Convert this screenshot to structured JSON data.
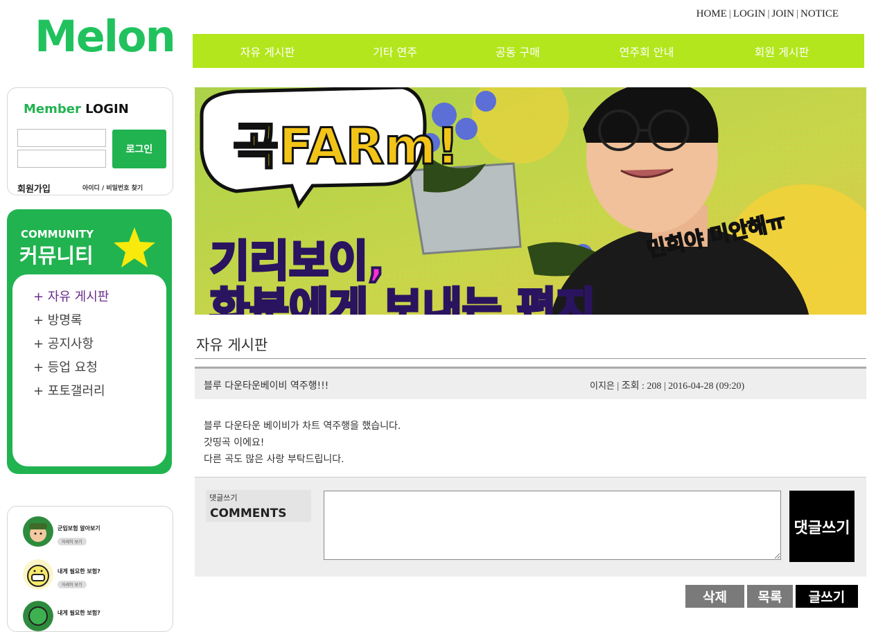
{
  "logo": {
    "text": "Melon",
    "color": "#21c25e"
  },
  "top_links": [
    "HOME",
    "LOGIN",
    "JOIN",
    "NOTICE"
  ],
  "nav": [
    "자유 게시판",
    "기타 연주",
    "공동 구매",
    "연주회 안내",
    "회원 게시판"
  ],
  "login": {
    "title_green": "Member",
    "title_black": "LOGIN",
    "button": "로그인",
    "join": "회원가입",
    "find": "아이디 / 비밀번호 찾기"
  },
  "community": {
    "title_en": "COMMUNITY",
    "title_ko": "커뮤니티",
    "items": [
      "+ 자유 게시판",
      "+ 방명록",
      "+ 공지사항",
      "+ 등업 요청",
      "+ 포토갤러리"
    ]
  },
  "side_banners": [
    {
      "title": "군입보험 알아보기",
      "pill": "자세히 보기"
    },
    {
      "title": "내게 필요한 보험?",
      "pill": "자세히 보기"
    },
    {
      "title": "내게 필요한 보험?"
    }
  ],
  "hero": {
    "bubble_text": "곡FARm!",
    "caption_line1": "기리보이,",
    "caption_line2": "화분에게 보내는 편지",
    "side_text": "민희야 미안해ㅠ"
  },
  "board": {
    "title": "자유 게시판",
    "post_title": "블루 다운타운베이비 역주행!!!",
    "author": "이지은",
    "views": "| 조회 : 208 | 2016-04-28 (09:20)",
    "body": [
      "블루 다운타운 베이비가 차트 역주행을 했습니다.",
      "갓띵곡 이에요!",
      "다른 곡도 많은 사랑 부탁드립니다."
    ],
    "comment_label_ko": "댓글쓰기",
    "comment_label_en": "COMMENTS",
    "comment_submit": "댓글쓰기",
    "buttons": {
      "delete": "삭제",
      "list": "목록",
      "write": "글쓰기"
    }
  }
}
